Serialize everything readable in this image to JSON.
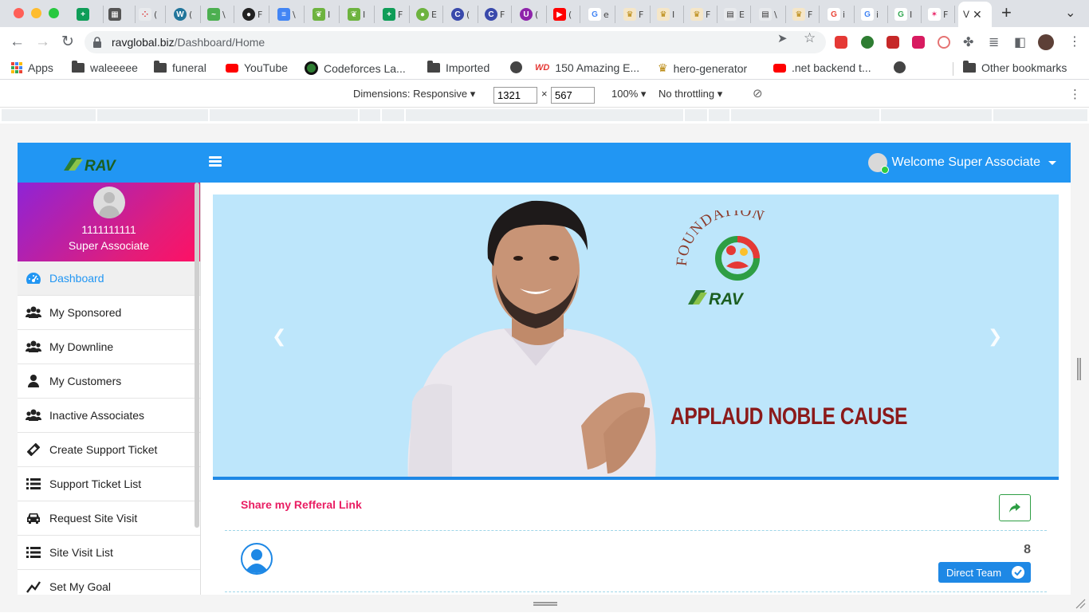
{
  "browser": {
    "active_tab_title": "V",
    "url_host": "ravglobal.biz",
    "url_path": "/Dashboard/Home",
    "bookmarks": [
      {
        "label": "Apps",
        "icon": "apps-grid-icon"
      },
      {
        "label": "waleeeee",
        "icon": "folder-icon"
      },
      {
        "label": "funeral",
        "icon": "folder-icon"
      },
      {
        "label": "YouTube",
        "icon": "youtube-icon"
      },
      {
        "label": "Codeforces La...",
        "icon": "alien-icon"
      },
      {
        "label": "Imported",
        "icon": "folder-icon"
      },
      {
        "label": "",
        "icon": "globe-icon"
      },
      {
        "label": "150 Amazing E...",
        "icon": "wd-icon"
      },
      {
        "label": "hero-generator",
        "icon": "hero-icon"
      },
      {
        "label": ".net backend t...",
        "icon": "youtube-icon"
      },
      {
        "label": "",
        "icon": "globe-icon"
      },
      {
        "label": "Other bookmarks",
        "icon": "folder-icon"
      }
    ]
  },
  "devtools": {
    "dimensions_label": "Dimensions: Responsive",
    "width": "1321",
    "height": "567",
    "times": "×",
    "zoom": "100%",
    "throttling": "No throttling"
  },
  "header": {
    "welcome": "Welcome Super Associate"
  },
  "sidebar": {
    "user_id": "1111111111",
    "user_role": "Super Associate",
    "items": [
      {
        "label": "Dashboard",
        "icon": "dashboard-icon",
        "active": true
      },
      {
        "label": "My Sponsored",
        "icon": "users-icon"
      },
      {
        "label": "My Downline",
        "icon": "users-icon"
      },
      {
        "label": "My Customers",
        "icon": "user-icon"
      },
      {
        "label": "Inactive Associates",
        "icon": "users-icon"
      },
      {
        "label": "Create Support Ticket",
        "icon": "ticket-icon"
      },
      {
        "label": "Support Ticket List",
        "icon": "list-icon"
      },
      {
        "label": "Request Site Visit",
        "icon": "car-icon"
      },
      {
        "label": "Site Visit List",
        "icon": "list-icon"
      },
      {
        "label": "Set My Goal",
        "icon": "goal-icon"
      }
    ]
  },
  "banner": {
    "foundation_text": "FOUNDATION",
    "logo_text": "RAV",
    "headline": "APPLAUD NOBLE CAUSE"
  },
  "referral": {
    "title": "Share my Refferal Link",
    "direct_team_count": "8",
    "direct_team_label": "Direct Team"
  },
  "colors": {
    "topbar": "#2196f3",
    "referral_title": "#e91e63",
    "banner_bg": "#bde6fb",
    "headline": "#8b1a1a"
  }
}
